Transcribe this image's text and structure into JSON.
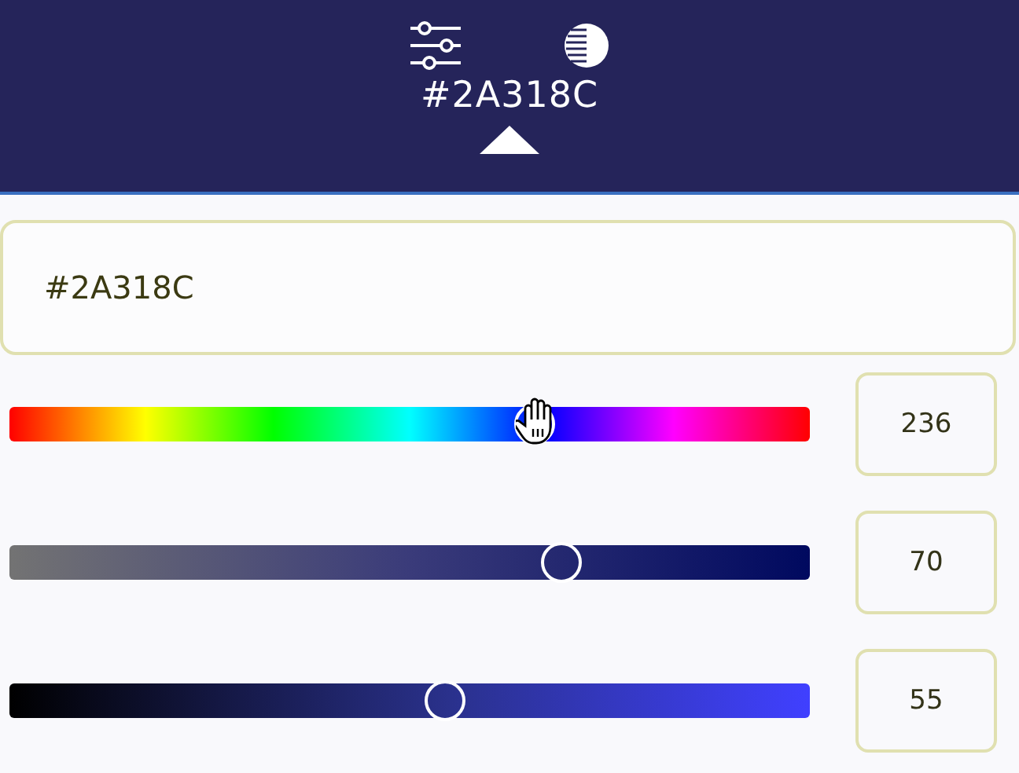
{
  "header": {
    "title": "#2A318C"
  },
  "hex_field": {
    "value": "#2A318C"
  },
  "sliders": [
    {
      "kind": "hue",
      "level": 0.656,
      "reading": "236"
    },
    {
      "kind": "saturation",
      "level": 0.69,
      "reading": "70"
    },
    {
      "kind": "lightness",
      "level": 0.545,
      "reading": "55"
    }
  ]
}
